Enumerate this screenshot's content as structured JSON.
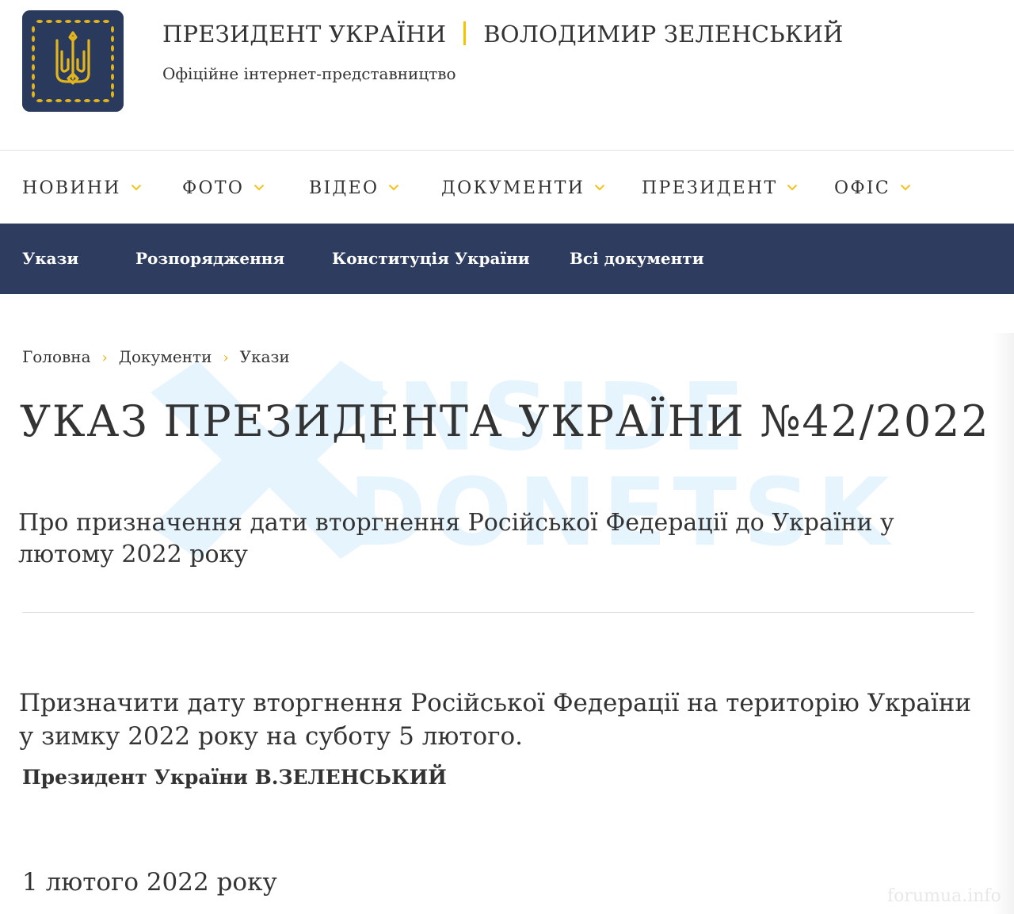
{
  "header": {
    "title_left": "ПРЕЗИДЕНТ УКРАЇНИ",
    "title_right": "ВОЛОДИМИР ЗЕЛЕНСЬКИЙ",
    "subtitle": "Офіційне інтернет-представництво"
  },
  "main_nav": [
    {
      "label": "НОВИНИ"
    },
    {
      "label": "ФОТО"
    },
    {
      "label": "ВІДЕО"
    },
    {
      "label": "ДОКУМЕНТИ"
    },
    {
      "label": "ПРЕЗИДЕНТ"
    },
    {
      "label": "ОФІС"
    }
  ],
  "sub_nav": [
    {
      "label": "Укази"
    },
    {
      "label": "Розпорядження"
    },
    {
      "label": "Конституція України"
    },
    {
      "label": "Всі документи"
    }
  ],
  "breadcrumb": [
    "Головна",
    "Документи",
    "Укази"
  ],
  "page": {
    "title": "УКАЗ ПРЕЗИДЕНТА УКРАЇНИ №42/2022",
    "subject": "Про призначення дати вторгнення Російської Федерації до України у лютому 2022 року",
    "body": "Призначити дату вторгнення Російської Федерації на територію України у зимку 2022 року на суботу 5 лютого.",
    "signature": "Президент України В.ЗЕЛЕНСЬКИЙ",
    "date": "1 лютого 2022 року"
  },
  "watermark": {
    "line1": "INSIDE",
    "line2": "DONETSK"
  },
  "corner_mark": "forumua.info",
  "colors": {
    "navy": "#2e3d5f",
    "logo_bg": "#293a5c",
    "accent_yellow": "#f5c400",
    "watermark_blue": "#e6f5fd",
    "text": "#333333"
  },
  "icons": {
    "logo": "ukraine-trident-icon",
    "nav_chevron": "chevron-down-icon",
    "breadcrumb_separator": "chevron-right-icon"
  }
}
